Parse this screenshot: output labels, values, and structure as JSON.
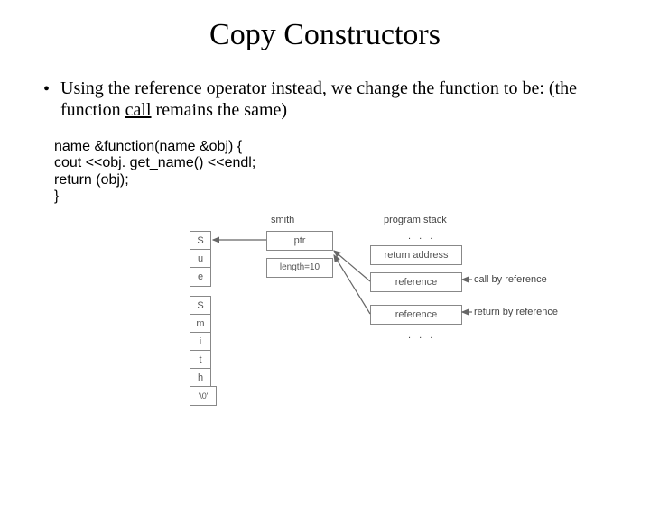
{
  "title": "Copy Constructors",
  "bullet": {
    "pre": "Using the reference operator instead, we change the function to be: (the function ",
    "underlined": "call",
    "post": " remains the same)"
  },
  "code": {
    "l1": "name &function(name &obj) {",
    "l2": "  cout <<obj. get_name() <<endl;",
    "l3": "  return (obj);",
    "l4": "}"
  },
  "diagram": {
    "smith_label": "smith",
    "sue": [
      "S",
      "u",
      "e"
    ],
    "smith_chars": [
      "S",
      "m",
      "i",
      "t",
      "h",
      "'\\0'"
    ],
    "ptr_label": "ptr",
    "length_label": "length=10",
    "stack_title": "program stack",
    "stack": [
      "return address",
      "reference",
      "reference"
    ],
    "dots_top": ". . .",
    "dots_bottom": ". . .",
    "call_by_ref": "call by reference",
    "return_by_ref": "return by reference"
  }
}
